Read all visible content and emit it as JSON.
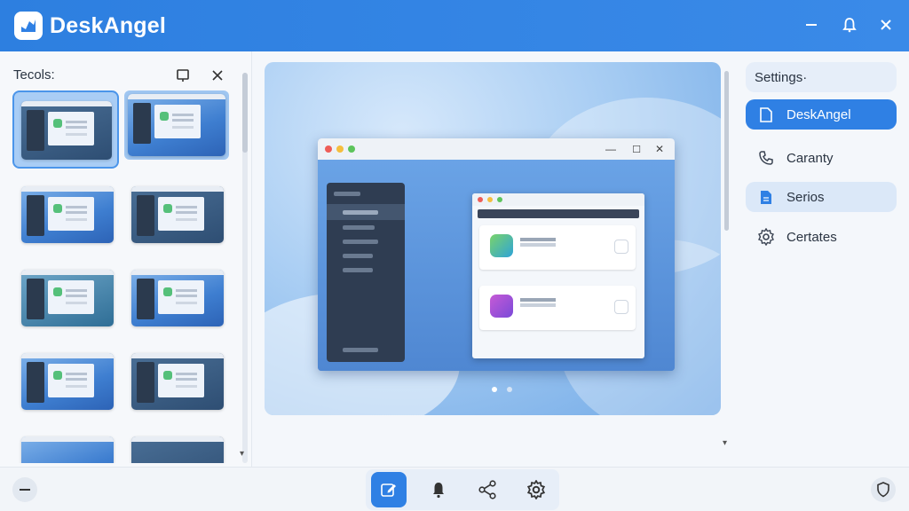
{
  "app": {
    "title": "DeskAngel"
  },
  "left_panel": {
    "header": "Tecols:"
  },
  "right_panel": {
    "items": [
      {
        "label": "Settings·",
        "icon": "none"
      },
      {
        "label": "DeskAngel",
        "icon": "document-icon",
        "active": true
      },
      {
        "label": "Caranty",
        "icon": "phone-icon"
      },
      {
        "label": "Serios",
        "icon": "document-icon"
      },
      {
        "label": "Certates",
        "icon": "gear-icon"
      }
    ]
  },
  "colors": {
    "accent": "#2f80e4",
    "titlebar": "#3a8ae8",
    "active_item": "#2f80e4"
  }
}
